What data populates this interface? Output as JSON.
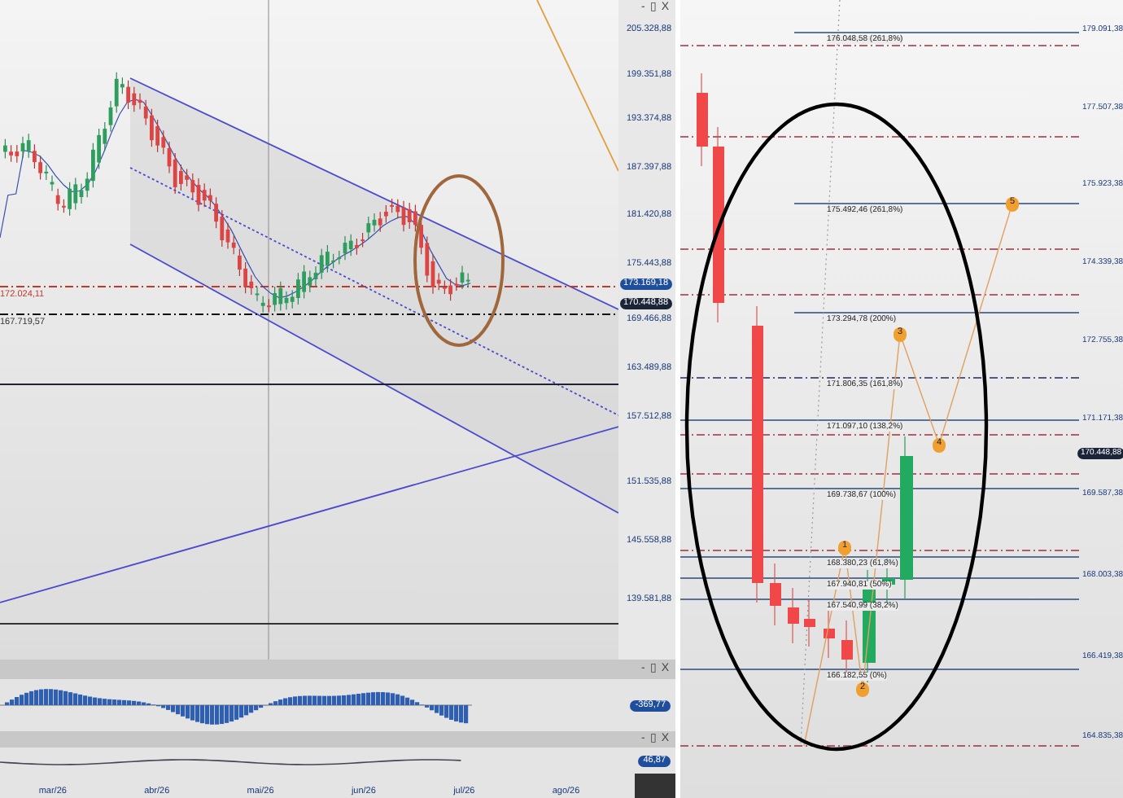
{
  "left_chart": {
    "window_controls": [
      "-",
      "▯",
      "X"
    ],
    "axis_labels": [
      "205.328,88",
      "199.351,88",
      "193.374,88",
      "187.397,88",
      "181.420,88",
      "175.443,88",
      "169.466,88",
      "163.489,88",
      "157.512,88",
      "151.535,88",
      "145.558,88",
      "139.581,88"
    ],
    "price_badges": [
      {
        "text": "173.169,18",
        "kind": "blue"
      },
      {
        "text": "170.448,88",
        "kind": "dark"
      }
    ],
    "line_labels": [
      {
        "text": "172.024,11",
        "kind": "red"
      },
      {
        "text": "167.719,57",
        "kind": "dark"
      }
    ]
  },
  "indicator_1": {
    "window_controls": [
      "-",
      "▯",
      "X"
    ],
    "value": "-369,77"
  },
  "indicator_2": {
    "window_controls": [
      "-",
      "▯",
      "X"
    ],
    "value": "46,87"
  },
  "date_axis": {
    "months": [
      "mar/26",
      "abr/26",
      "mai/26",
      "jun/26",
      "jul/26",
      "ago/26"
    ]
  },
  "right_chart": {
    "axis_labels": [
      "179.091,38",
      "177.507,38",
      "175.923,38",
      "174.339,38",
      "172.755,38",
      "171.171,38",
      "169.587,38",
      "168.003,38",
      "166.419,38",
      "164.835,38"
    ],
    "price_badge": "170.448,88",
    "fib_levels": [
      {
        "label": "176.048,58 (261,8%)"
      },
      {
        "label": "175.492,46 (261,8%)"
      },
      {
        "label": "173.294,78 (200%)"
      },
      {
        "label": "171.806,35 (161,8%)"
      },
      {
        "label": "171.097,10 (138,2%)"
      },
      {
        "label": "169.738,67 (100%)"
      },
      {
        "label": "168.380,23 (61,8%)"
      },
      {
        "label": "167.940,81 (50%)"
      },
      {
        "label": "167.540,99 (38,2%)"
      },
      {
        "label": "166.182,55 (0%)"
      }
    ],
    "wave_points": [
      "5",
      "3",
      "4",
      "1",
      "2"
    ]
  }
}
